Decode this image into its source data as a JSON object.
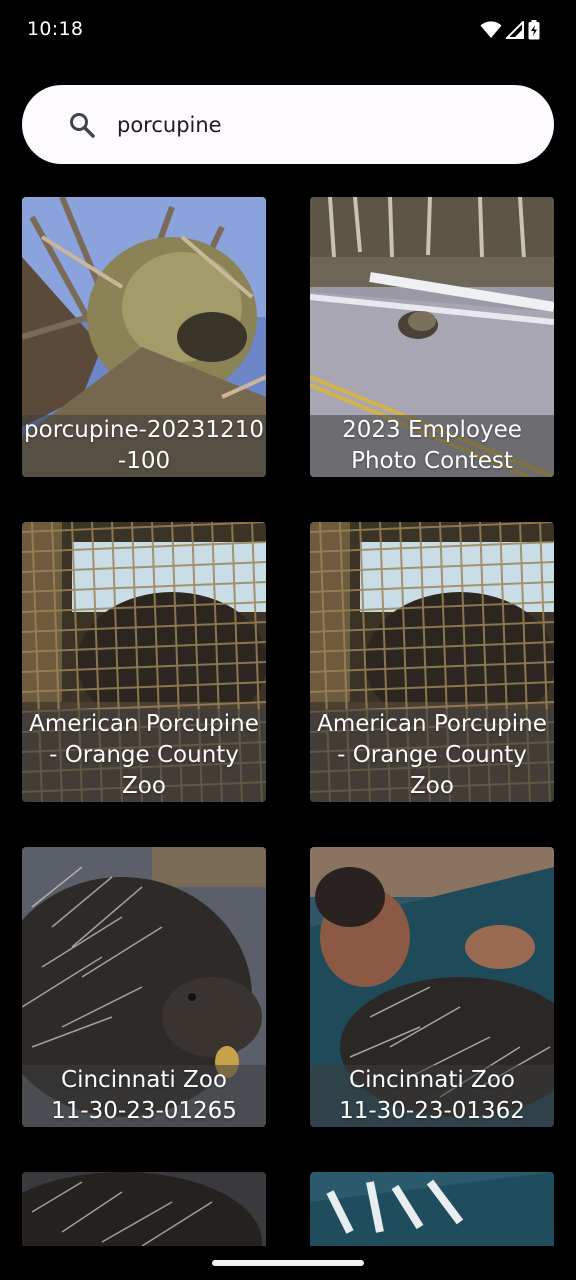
{
  "status_bar": {
    "time": "10:18",
    "icons": [
      "wifi-icon",
      "signal-icon",
      "battery-charging-icon"
    ]
  },
  "search": {
    "query": "porcupine",
    "icon": "search-icon"
  },
  "results": [
    {
      "caption_lines": [
        "porcupine-20231210",
        "-100"
      ]
    },
    {
      "caption_lines": [
        "2023 Employee",
        "Photo Contest"
      ]
    },
    {
      "caption_lines": [
        "American Porcupine",
        "- Orange County",
        "Zoo"
      ]
    },
    {
      "caption_lines": [
        "American Porcupine",
        "- Orange County",
        "Zoo"
      ]
    },
    {
      "caption_lines": [
        "Cincinnati Zoo",
        "11-30-23-01265"
      ]
    },
    {
      "caption_lines": [
        "Cincinnati Zoo",
        "11-30-23-01362"
      ]
    }
  ],
  "colors": {
    "background": "#000000",
    "search_bar": "#fdfbff",
    "text": "#ffffff"
  }
}
